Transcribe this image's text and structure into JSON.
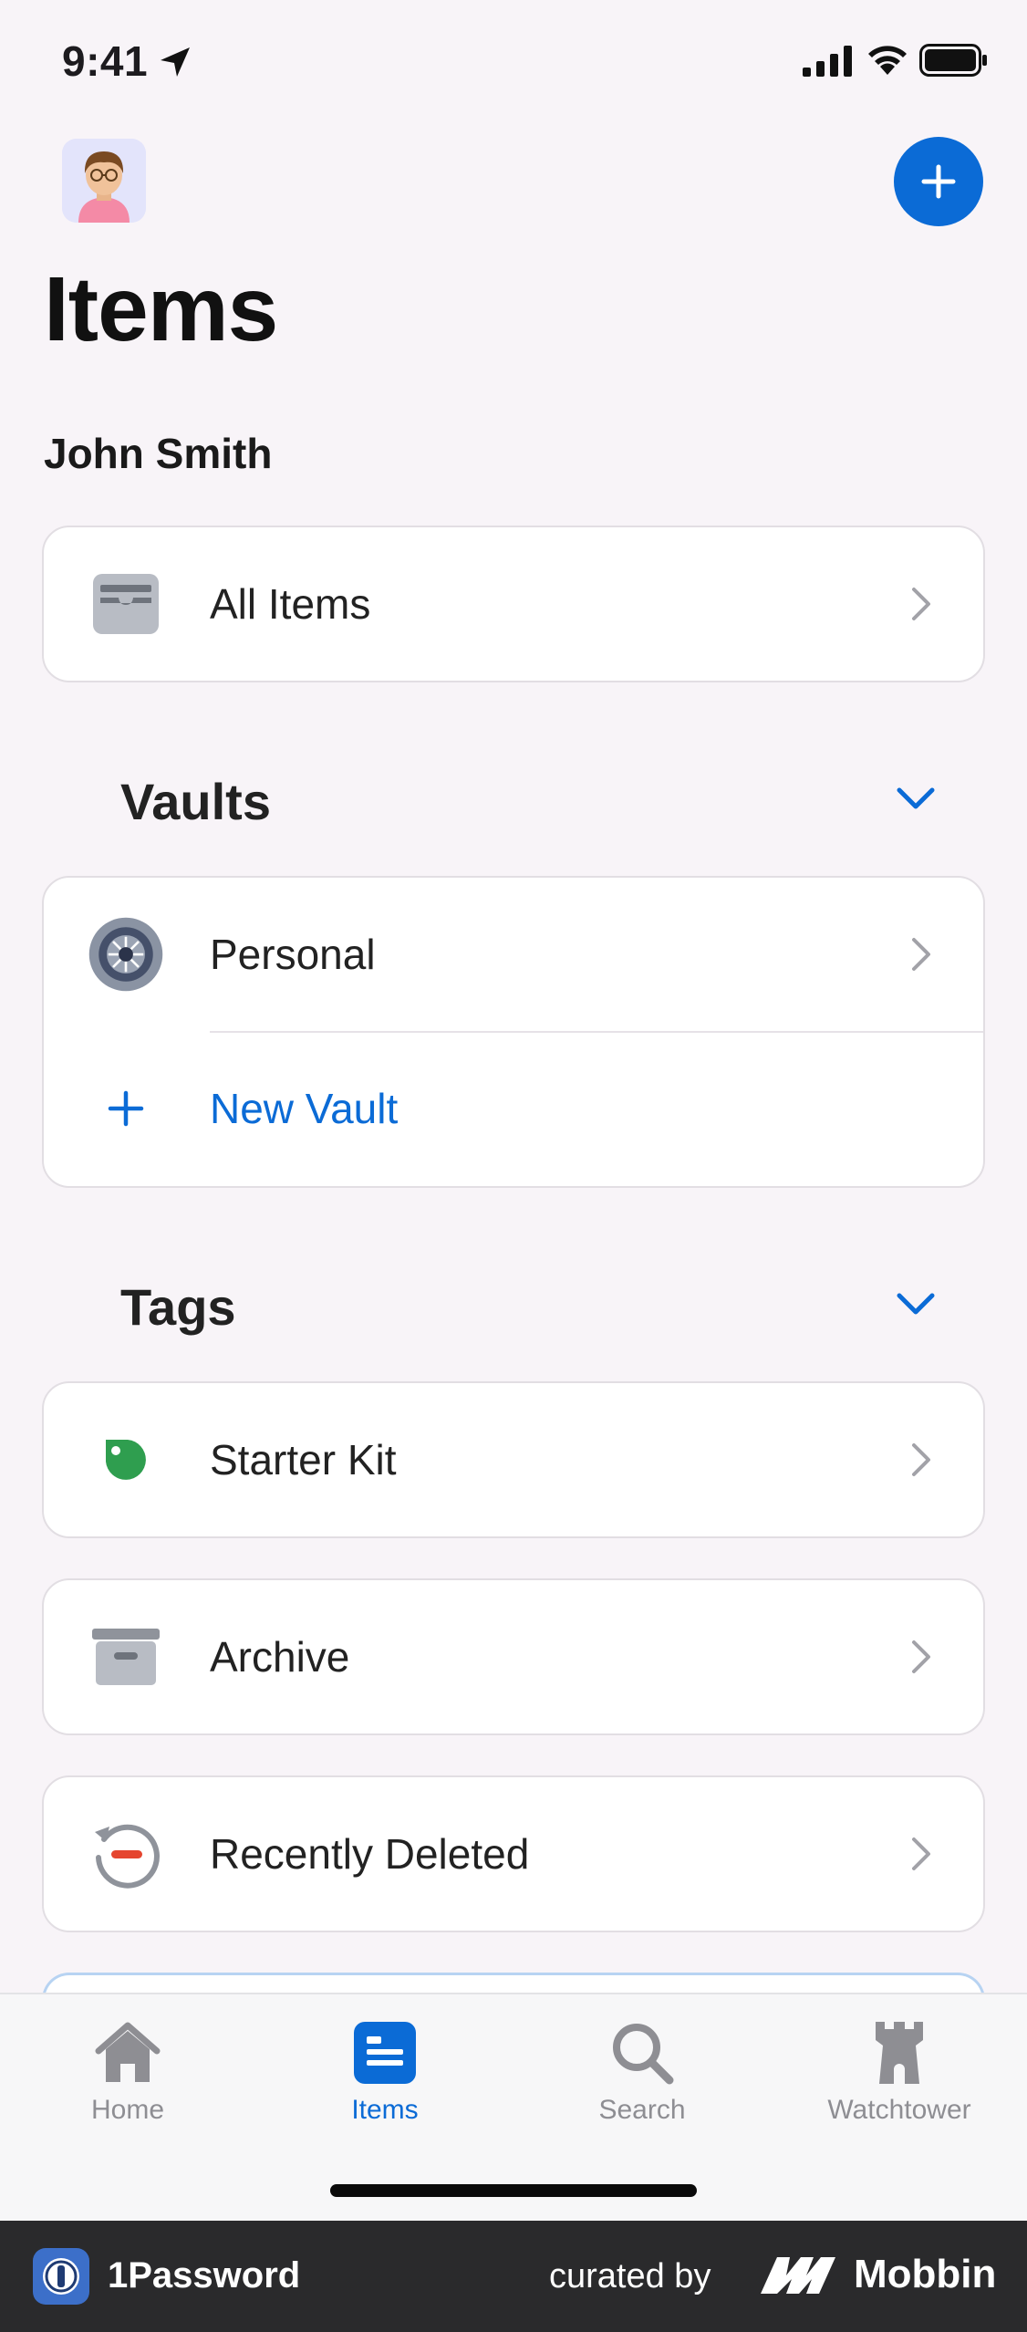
{
  "status_bar": {
    "time": "9:41"
  },
  "header": {
    "title": "Items"
  },
  "account": {
    "name": "John Smith"
  },
  "all_items": {
    "label": "All Items"
  },
  "vaults": {
    "heading": "Vaults",
    "items": [
      {
        "label": "Personal"
      }
    ],
    "new_vault_label": "New Vault"
  },
  "tags": {
    "heading": "Tags",
    "items": [
      {
        "label": "Starter Kit"
      }
    ]
  },
  "archive": {
    "label": "Archive"
  },
  "recently_deleted": {
    "label": "Recently Deleted"
  },
  "tab_bar": {
    "tabs": [
      {
        "label": "Home",
        "icon": "house-icon"
      },
      {
        "label": "Items",
        "icon": "items-list-icon",
        "active": true
      },
      {
        "label": "Search",
        "icon": "magnifier-icon"
      },
      {
        "label": "Watchtower",
        "icon": "tower-icon"
      }
    ]
  },
  "footer": {
    "app_name": "1Password",
    "curated_by": "curated by",
    "brand": "Mobbin"
  },
  "colors": {
    "accent": "#0b6bd6",
    "background": "#f8f4f8",
    "tag_green": "#2f9e4f"
  }
}
